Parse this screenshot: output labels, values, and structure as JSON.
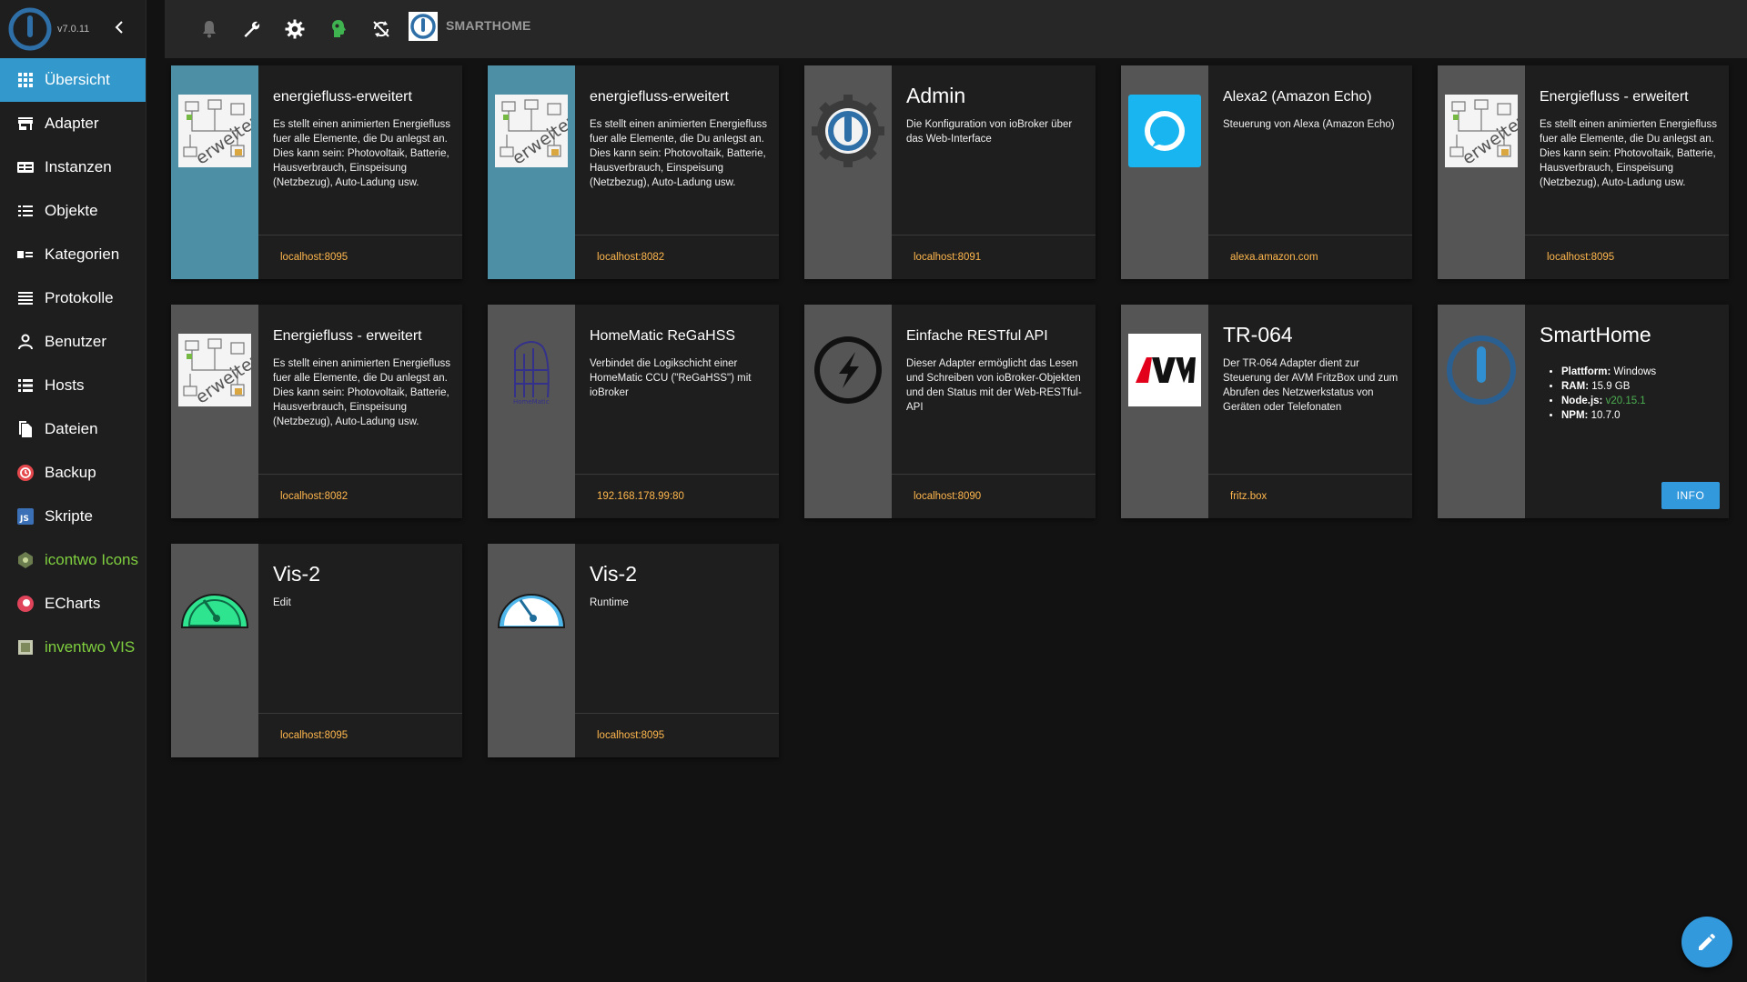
{
  "app": {
    "version": "v7.0.11",
    "title": "SMARTHOME"
  },
  "sidebar": {
    "items": [
      {
        "label": "Übersicht",
        "icon": "apps-icon",
        "active": true
      },
      {
        "label": "Adapter",
        "icon": "store-icon"
      },
      {
        "label": "Instanzen",
        "icon": "instances-icon"
      },
      {
        "label": "Objekte",
        "icon": "list-icon"
      },
      {
        "label": "Kategorien",
        "icon": "categories-icon"
      },
      {
        "label": "Protokolle",
        "icon": "logs-icon"
      },
      {
        "label": "Benutzer",
        "icon": "user-icon"
      },
      {
        "label": "Hosts",
        "icon": "hosts-icon"
      },
      {
        "label": "Dateien",
        "icon": "files-icon"
      },
      {
        "label": "Backup",
        "icon": "backup-icon"
      },
      {
        "label": "Skripte",
        "icon": "javascript-icon"
      },
      {
        "label": "icontwo Icons",
        "icon": "icontwo-icon"
      },
      {
        "label": "ECharts",
        "icon": "echarts-icon"
      },
      {
        "label": "inventwo VIS",
        "icon": "inventwo-icon"
      }
    ]
  },
  "toolbar": {
    "icons": [
      "bell-icon",
      "wrench-icon",
      "gear-icon",
      "expert-mode-icon",
      "refresh-icon"
    ]
  },
  "cards": [
    {
      "title": "energiefluss-erweitert",
      "desc": "Es stellt einen animierten Energiefluss fuer alle Elemente, die Du anlegst an. Dies kann sein: Photovoltaik, Batterie, Hausverbrauch, Einspeisung (Netzbezug), Auto-Ladung usw.",
      "link": "localhost:8095"
    },
    {
      "title": "energiefluss-erweitert",
      "desc": "Es stellt einen animierten Energiefluss fuer alle Elemente, die Du anlegst an. Dies kann sein: Photovoltaik, Batterie, Hausverbrauch, Einspeisung (Netzbezug), Auto-Ladung usw.",
      "link": "localhost:8082"
    },
    {
      "title": "Admin",
      "desc": "Die Konfiguration von ioBroker über das Web-Interface",
      "link": "localhost:8091"
    },
    {
      "title": "Alexa2 (Amazon Echo)",
      "desc": "Steuerung von Alexa (Amazon Echo)",
      "link": "alexa.amazon.com"
    },
    {
      "title": "Energiefluss - erweitert",
      "desc": "Es stellt einen animierten Energiefluss fuer alle Elemente, die Du anlegst an. Dies kann sein: Photovoltaik, Batterie, Hausverbrauch, Einspeisung (Netzbezug), Auto-Ladung usw.",
      "link": "localhost:8095"
    },
    {
      "title": "Energiefluss - erweitert",
      "desc": "Es stellt einen animierten Energiefluss fuer alle Elemente, die Du anlegst an. Dies kann sein: Photovoltaik, Batterie, Hausverbrauch, Einspeisung (Netzbezug), Auto-Ladung usw.",
      "link": "localhost:8082"
    },
    {
      "title": "HomeMatic ReGaHSS",
      "desc": "Verbindet die Logikschicht einer HomeMatic CCU (\"ReGaHSS\") mit ioBroker",
      "link": "192.168.178.99:80"
    },
    {
      "title": "Einfache RESTful API",
      "desc": "Dieser Adapter ermöglicht das Lesen und Schreiben von ioBroker-Objekten und den Status mit der Web-RESTful-API",
      "link": "localhost:8090"
    },
    {
      "title": "TR-064",
      "desc": "Der TR-064 Adapter dient zur Steuerung der AVM FritzBox und zum Abrufen des Netzwerkstatus von Geräten oder Telefonaten",
      "link": "fritz.box"
    },
    {
      "title": "Vis-2",
      "desc": "Edit",
      "link": "localhost:8095"
    },
    {
      "title": "Vis-2",
      "desc": "Runtime",
      "link": "localhost:8095"
    }
  ],
  "host_card": {
    "title": "SmartHome",
    "platform_label": "Plattform:",
    "platform": "Windows",
    "ram_label": "RAM:",
    "ram": "15.9 GB",
    "node_label": "Node.js:",
    "node": "v20.15.1",
    "npm_label": "NPM:",
    "npm": "10.7.0",
    "button": "INFO"
  },
  "colors": {
    "accent": "#3399cc",
    "link": "#ffb74d",
    "green": "#7fcf3f"
  }
}
